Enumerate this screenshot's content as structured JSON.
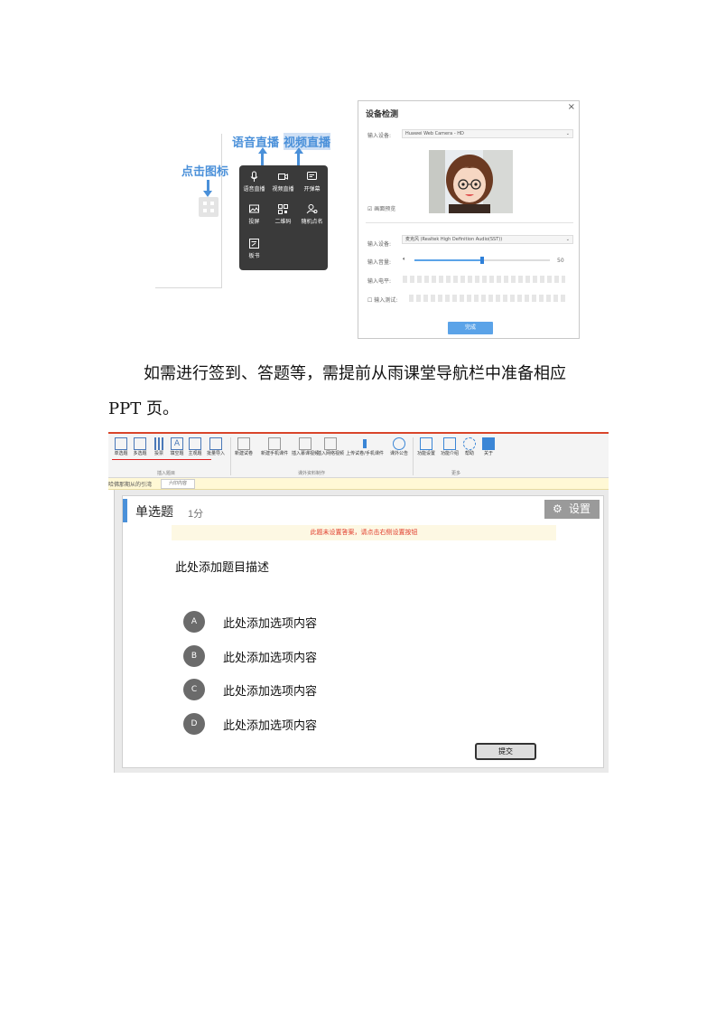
{
  "live_menu": {
    "callout_click_icon": "点击图标",
    "callout_voice": "语音直播",
    "callout_video": "视频直播",
    "items": [
      {
        "label": "语音直播",
        "icon": "microphone-icon"
      },
      {
        "label": "视频直播",
        "icon": "video-camera-icon"
      },
      {
        "label": "开弹幕",
        "icon": "danmaku-icon"
      },
      {
        "label": "投屏",
        "icon": "screen-cast-icon"
      },
      {
        "label": "二维码",
        "icon": "qr-code-icon"
      },
      {
        "label": "随机点名",
        "icon": "random-rollcall-icon"
      },
      {
        "label": "板书",
        "icon": "whiteboard-icon"
      }
    ]
  },
  "device_check": {
    "title": "设备检测",
    "close": "×",
    "video_input_label": "输入设备:",
    "video_input_value": "Huawei Web Camera - HD",
    "mirror_label": "画面预览",
    "audio_input_label": "输入设备:",
    "audio_input_value": "麦克风 (Realtek High Definition Audio(SST))",
    "volume_label": "输入音量:",
    "volume_value": "50",
    "volume_level": 0.5,
    "level_label": "输入电平:",
    "test_label": "输入测试:",
    "done_label": "完成"
  },
  "paragraph": {
    "line1": "如需进行签到、答题等，需提前从雨课堂导航栏中准备相应",
    "line2": "PPT 页。"
  },
  "ribbon": {
    "buttons": [
      "单选题",
      "多选题",
      "投票",
      "填空题",
      "主观题",
      "批量导入",
      "新建试卷",
      "新建手机课件",
      "插入慕课视频",
      "插入网络视频",
      "上传试卷/手机课件",
      "课外公告",
      "功能设置",
      "功能介绍",
      "帮助",
      "关于"
    ],
    "group_insert": "插入题目",
    "group_extracurricular": "课外资料制作",
    "group_more": "更多"
  },
  "addr": {
    "left": "哈佛那期从的引湾",
    "tab": "六印内容"
  },
  "question": {
    "type": "单选题",
    "score": "1分",
    "settings_label": "设置",
    "warning": "此题未设置答案，请点击右侧设置按钮",
    "description": "此处添加题目描述",
    "options": [
      {
        "letter": "A",
        "text": "此处添加选项内容"
      },
      {
        "letter": "B",
        "text": "此处添加选项内容"
      },
      {
        "letter": "C",
        "text": "此处添加选项内容"
      },
      {
        "letter": "D",
        "text": "此处添加选项内容"
      }
    ],
    "submit_label": "提交"
  }
}
